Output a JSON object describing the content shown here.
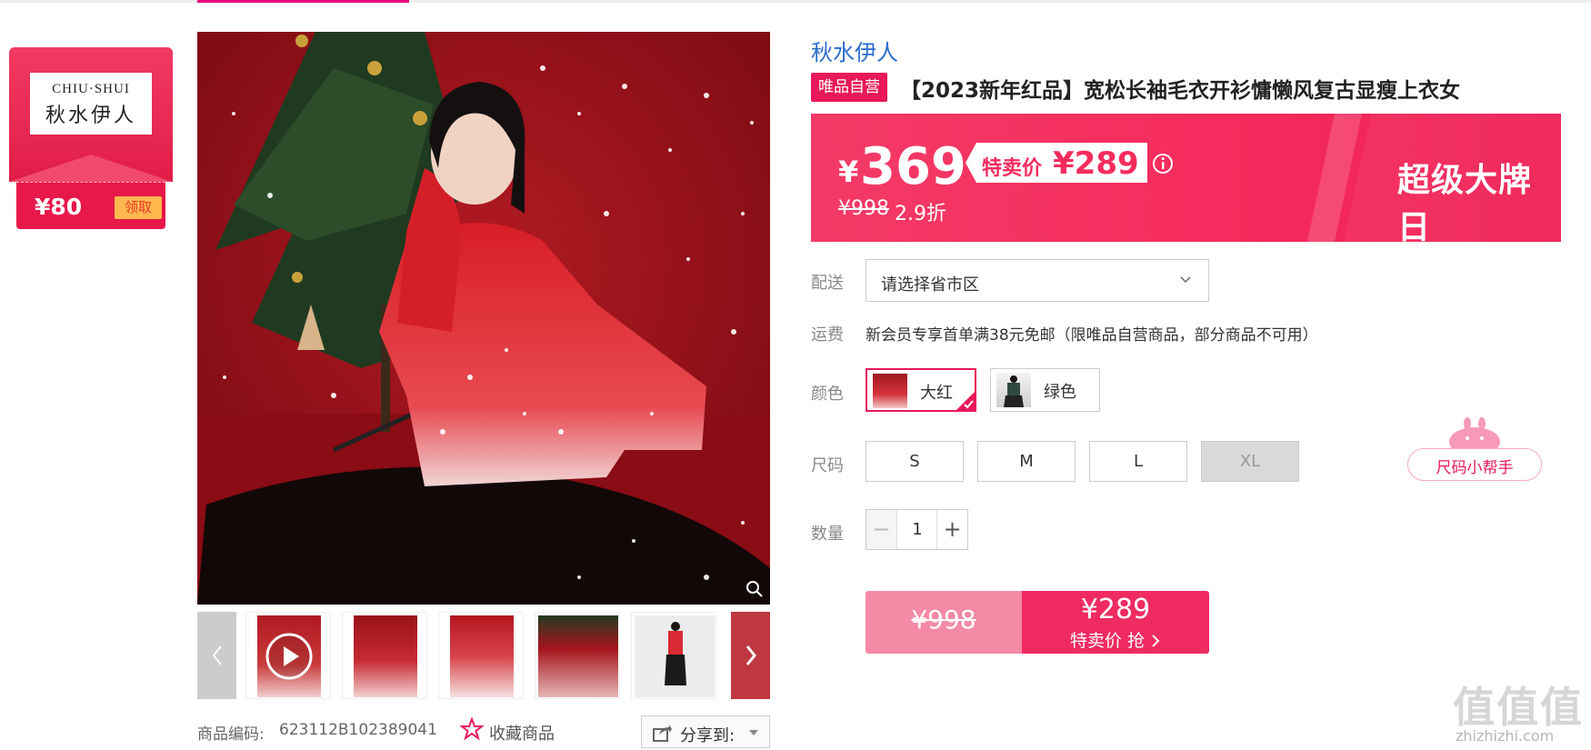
{
  "brand_card": {
    "logo_en": "CHIU·SHUI",
    "logo_cn": "秋水伊人",
    "coupon_amount": "¥80",
    "coupon_button": "领取"
  },
  "gallery": {
    "product_code_label": "商品编码:",
    "product_code": "623112B102389041",
    "favorite_label": "收藏商品",
    "share_label": "分享到:",
    "thumbnail_count": 6
  },
  "product": {
    "brand_name": "秋水伊人",
    "self_operated_badge": "唯品自营",
    "title": "【2023新年红品】宽松长袖毛衣开衫慵懒风复古显瘦上衣女"
  },
  "price_banner": {
    "currency": "¥",
    "price": "369",
    "special_label": "特卖价",
    "special_price": "¥289",
    "original_price": "¥998",
    "discount": "2.9折",
    "event_name": "超级大牌日"
  },
  "delivery": {
    "label": "配送",
    "select_placeholder": "请选择省市区"
  },
  "shipping": {
    "label": "运费",
    "text": "新会员专享首单满38元免邮（限唯品自营商品，部分商品不可用）"
  },
  "color": {
    "label": "颜色",
    "options": [
      {
        "label": "大红",
        "selected": true
      },
      {
        "label": "绿色",
        "selected": false
      }
    ]
  },
  "size": {
    "label": "尺码",
    "options": [
      {
        "label": "S",
        "available": true
      },
      {
        "label": "M",
        "available": true
      },
      {
        "label": "L",
        "available": true
      },
      {
        "label": "XL",
        "available": false
      }
    ],
    "helper_label": "尺码小帮手"
  },
  "quantity": {
    "label": "数量",
    "value": "1",
    "minus": "−",
    "plus": "+"
  },
  "buy_button": {
    "original_price": "¥998",
    "price": "¥289",
    "action_text": "特卖价 抢"
  },
  "watermark": {
    "big": "值值值",
    "small": "zhizhizhi.com"
  },
  "colors": {
    "accent": "#e8185a",
    "banner": "#f52c5d",
    "brand_blue": "#2a6dcc"
  }
}
